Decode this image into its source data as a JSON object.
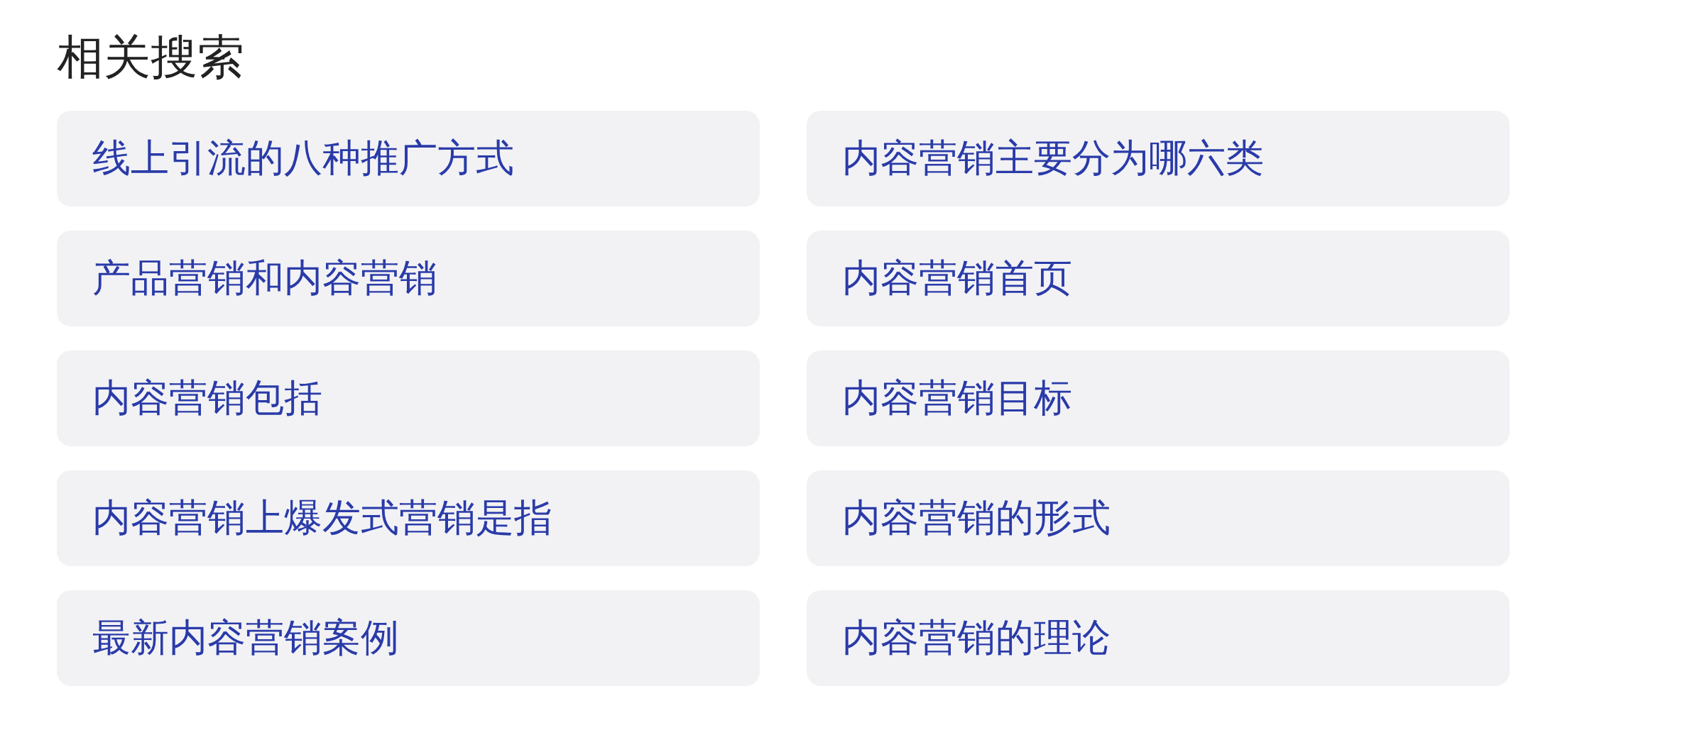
{
  "title": "相关搜索",
  "suggestions": [
    {
      "text": "线上引流的八种推广方式"
    },
    {
      "text": "内容营销主要分为哪六类"
    },
    {
      "text": "产品营销和内容营销"
    },
    {
      "text": "内容营销首页"
    },
    {
      "text": "内容营销包括"
    },
    {
      "text": "内容营销目标"
    },
    {
      "text": "内容营销上爆发式营销是指"
    },
    {
      "text": "内容营销的形式"
    },
    {
      "text": "最新内容营销案例"
    },
    {
      "text": "内容营销的理论"
    }
  ]
}
